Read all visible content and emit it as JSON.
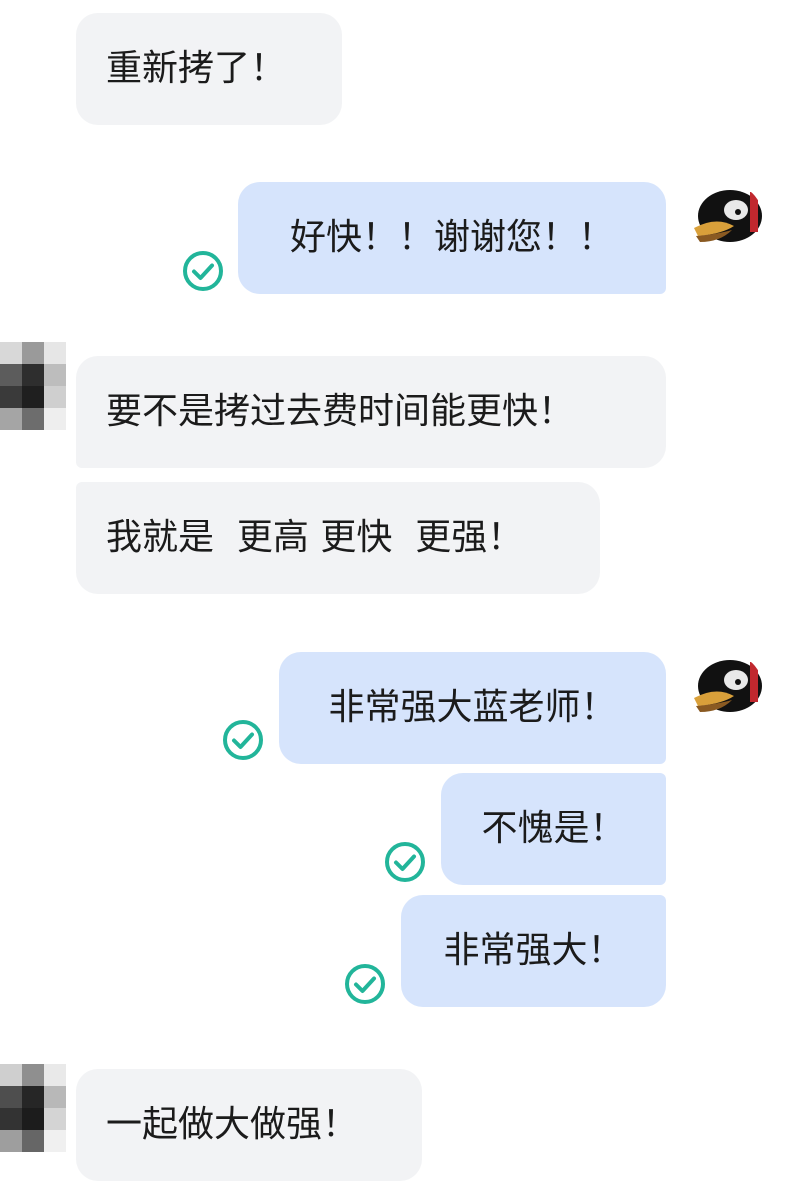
{
  "messages": [
    {
      "side": "received",
      "text": "重新拷了！"
    },
    {
      "side": "sent",
      "text": "好快！！谢谢您！！",
      "status": "read"
    },
    {
      "side": "received",
      "text": "要不是拷过去费时间能更快！"
    },
    {
      "side": "received",
      "text": "我就是  更高 更快  更强！"
    },
    {
      "side": "sent",
      "text": "非常强大蓝老师！",
      "status": "read"
    },
    {
      "side": "sent",
      "text": "不愧是！",
      "status": "read"
    },
    {
      "side": "sent",
      "text": "非常强大！",
      "status": "read"
    },
    {
      "side": "received",
      "text": "一起做大做强！"
    }
  ],
  "colors": {
    "received_bubble": "#f2f3f5",
    "sent_bubble": "#d6e4fc",
    "read_check": "#22b59a",
    "text": "#1b1b1b"
  },
  "icons": {
    "read_status": "check-circle-icon",
    "sender_avatar": "duck-avatar",
    "contact_avatar": "pixelated-avatar"
  }
}
